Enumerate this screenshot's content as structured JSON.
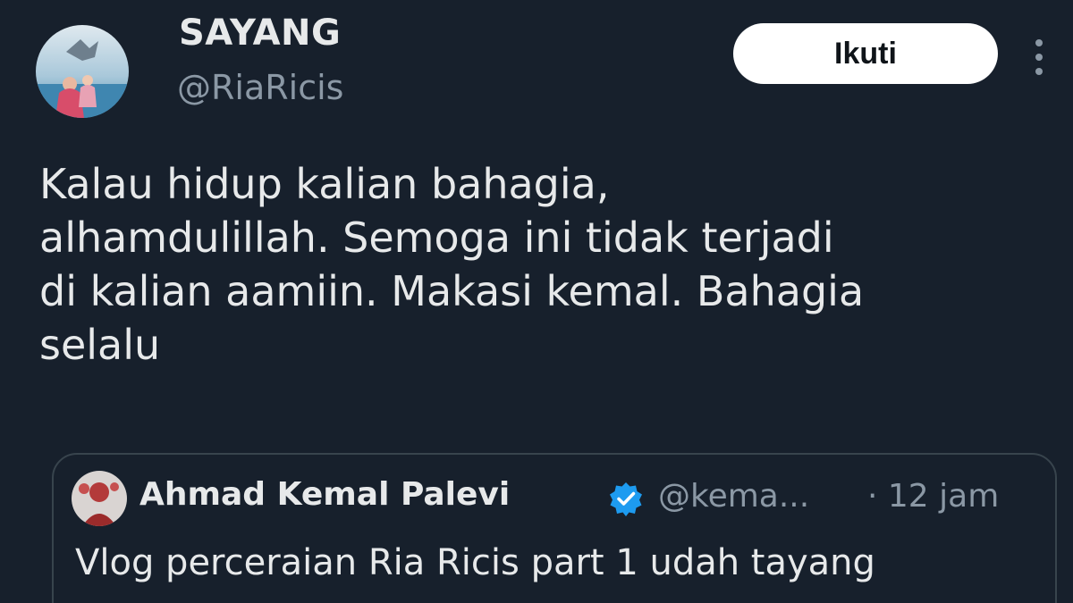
{
  "tweet": {
    "display_name": "SAYANG",
    "handle": "@RiaRicis",
    "follow_label": "Ikuti",
    "more_icon": "more-vertical-icon",
    "text_lines": [
      "Kalau hidup kalian bahagia,",
      "alhamdulillah. Semoga ini tidak terjadi",
      "di kalian aamiin. Makasi kemal. Bahagia",
      "selalu"
    ]
  },
  "quote": {
    "display_name": "Ahmad Kemal Palevi",
    "verified_icon": "verified-badge-icon",
    "handle": "@kema...",
    "time": "· 12 jam",
    "text": "Vlog perceraian Ria Ricis part 1 udah tayang"
  },
  "colors": {
    "background": "#17202c",
    "primary_text": "#e7e9ea",
    "secondary_text": "#8b98a5",
    "verified": "#1d9bf0",
    "border": "#38444d"
  }
}
